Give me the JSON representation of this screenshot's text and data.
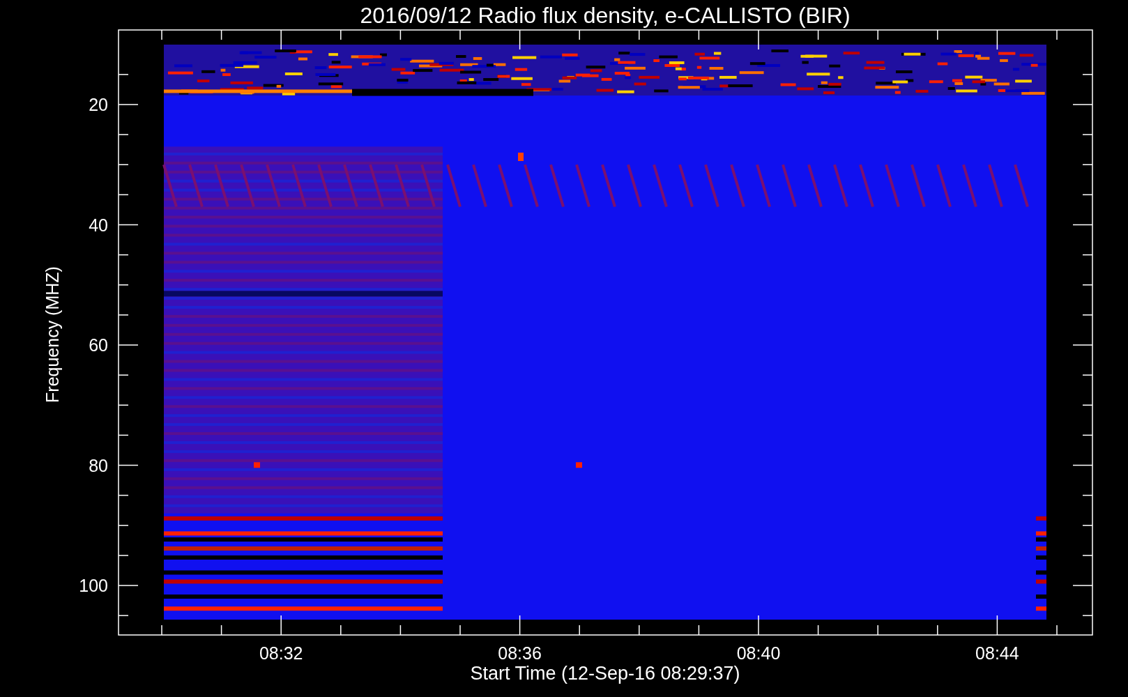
{
  "title": "2016/09/12  Radio flux density, e-CALLISTO (BIR)",
  "y_axis": {
    "label": "Frequency (MHZ)",
    "tick_labels": [
      "20",
      "40",
      "60",
      "80",
      "100"
    ]
  },
  "x_axis": {
    "label": "Start Time (12-Sep-16 08:29:37)",
    "tick_labels": [
      "08:32",
      "08:36",
      "08:40",
      "08:44"
    ]
  }
}
